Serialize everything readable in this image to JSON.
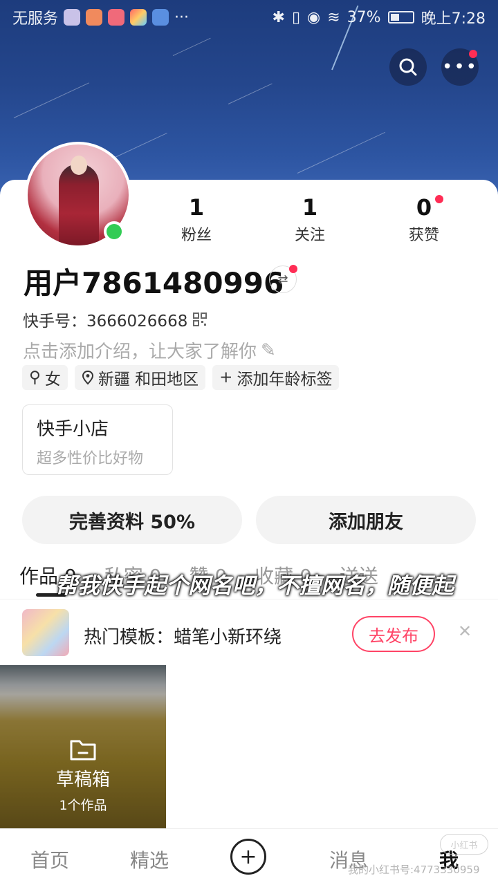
{
  "status_bar": {
    "carrier": "无服务",
    "battery": "37%",
    "time": "晚上7:28"
  },
  "profile": {
    "username": "用户7861480996",
    "kuaishou_id_label": "快手号：",
    "kuaishou_id": "3666026668",
    "intro_placeholder": "点击添加介绍，让大家了解你",
    "stats": [
      {
        "value": "1",
        "label": "粉丝"
      },
      {
        "value": "1",
        "label": "关注"
      },
      {
        "value": "0",
        "label": "获赞"
      }
    ],
    "tags": {
      "gender": "女",
      "location": "新疆 和田地区",
      "add_age": "添加年龄标签"
    }
  },
  "shop": {
    "title": "快手小店",
    "subtitle": "超多性价比好物"
  },
  "actions": {
    "complete_profile": "完善资料 50%",
    "add_friends": "添加朋友"
  },
  "tabs": {
    "works": "作品 0",
    "private": "私密 0",
    "likes": "赞 0",
    "favorites": "收藏 0",
    "sent": "送送"
  },
  "overlay_caption": "帮我快手起个网名吧，不擅网名，随便起",
  "template_bar": {
    "text": "热门模板：蜡笔小新环绕",
    "button": "去发布"
  },
  "draft_box": {
    "title": "草稿箱",
    "count": "1个作品"
  },
  "bottom_nav": {
    "home": "首页",
    "featured": "精选",
    "messages": "消息",
    "me": "我"
  },
  "watermark": {
    "id_text": "我的小红书号:4773330959",
    "badge": "小红书"
  }
}
